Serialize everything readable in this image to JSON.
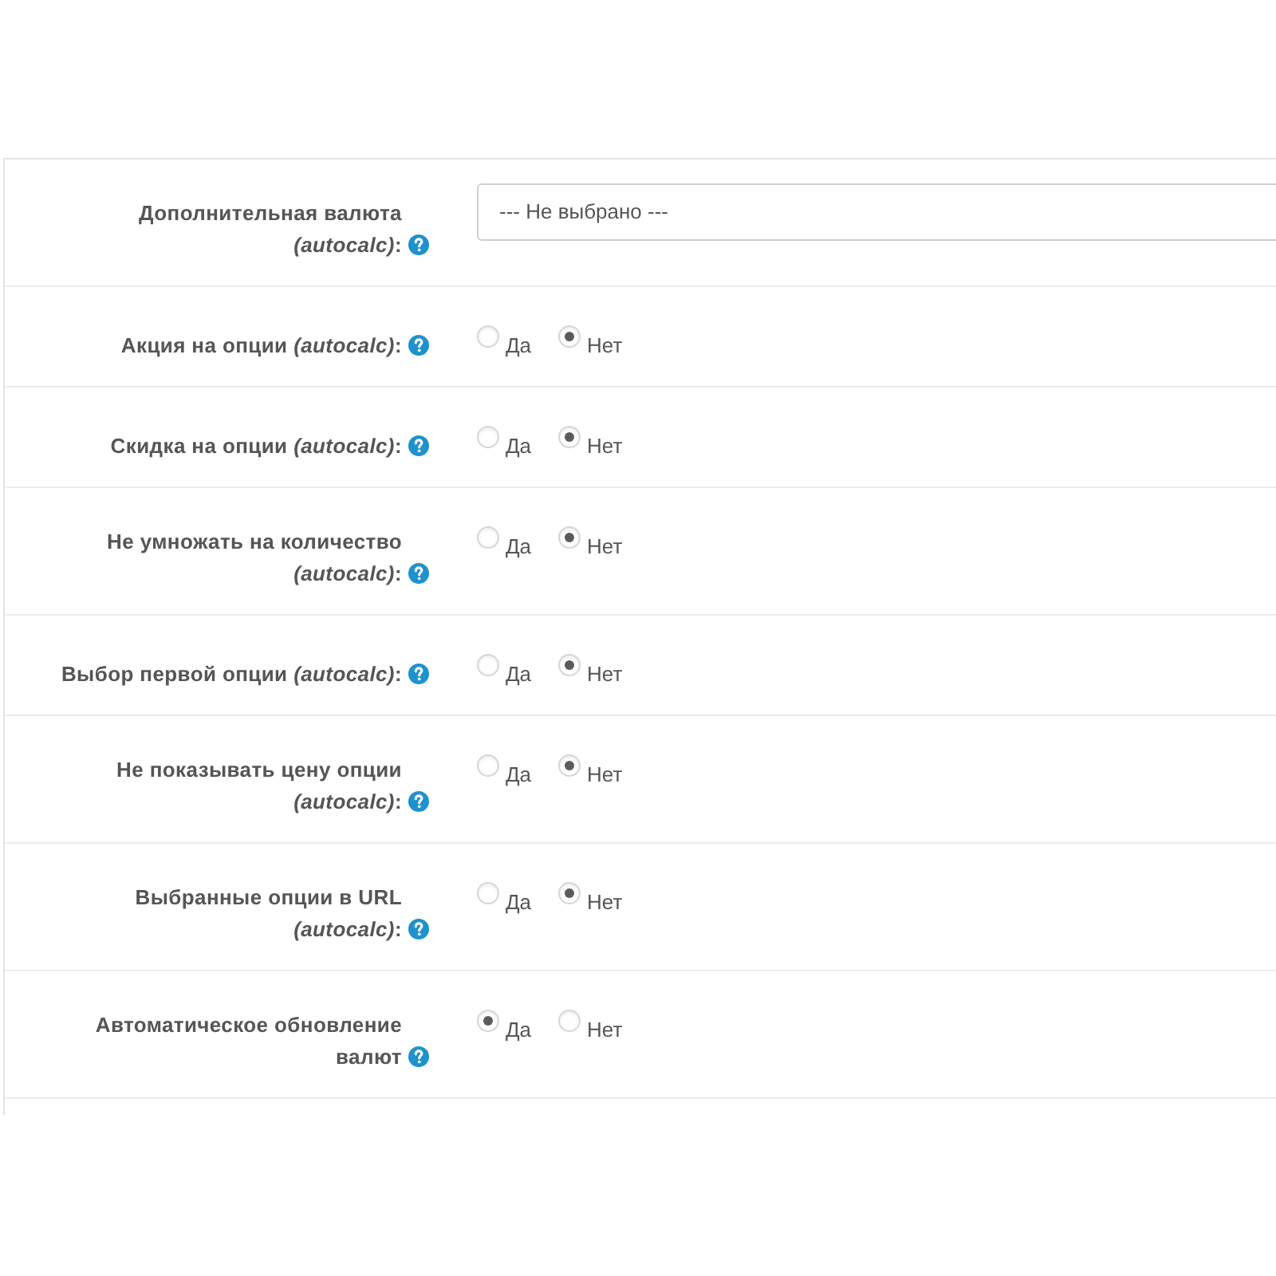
{
  "form": {
    "rows": [
      {
        "kind": "select",
        "label": "Дополнительная валюта *(autocalc)*:",
        "value": "--- Не выбрано ---"
      },
      {
        "kind": "radio",
        "label": "Акция на опции *(autocalc)*:",
        "options": [
          {
            "label": "Да",
            "selected": false
          },
          {
            "label": "Нет",
            "selected": true
          }
        ]
      },
      {
        "kind": "radio",
        "label": "Скидка на опции *(autocalc)*:",
        "options": [
          {
            "label": "Да",
            "selected": false
          },
          {
            "label": "Нет",
            "selected": true
          }
        ]
      },
      {
        "kind": "radio",
        "label": "Не умножать на количество *(autocalc)*:",
        "options": [
          {
            "label": "Да",
            "selected": false
          },
          {
            "label": "Нет",
            "selected": true
          }
        ]
      },
      {
        "kind": "radio",
        "label": "Выбор первой опции *(autocalc)*:",
        "options": [
          {
            "label": "Да",
            "selected": false
          },
          {
            "label": "Нет",
            "selected": true
          }
        ]
      },
      {
        "kind": "radio",
        "label": "Не показывать цену опции *(autocalc)*:",
        "options": [
          {
            "label": "Да",
            "selected": false
          },
          {
            "label": "Нет",
            "selected": true
          }
        ]
      },
      {
        "kind": "radio",
        "label": "Выбранные опции в URL *(autocalc)*:",
        "options": [
          {
            "label": "Да",
            "selected": false
          },
          {
            "label": "Нет",
            "selected": true
          }
        ]
      },
      {
        "kind": "radio",
        "label": "Автоматическое обновление валют",
        "options": [
          {
            "label": "Да",
            "selected": true
          },
          {
            "label": "Нет",
            "selected": false
          }
        ]
      }
    ]
  }
}
